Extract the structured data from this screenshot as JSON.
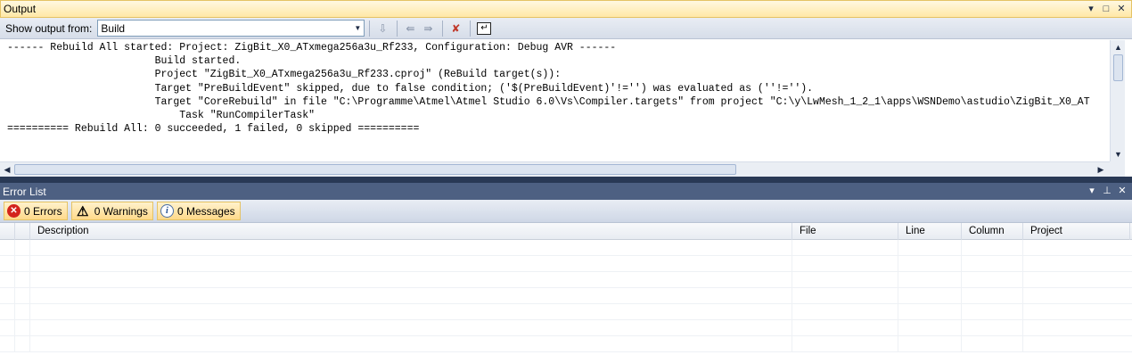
{
  "output": {
    "title": "Output",
    "show_output_label": "Show output from:",
    "source_selected": "Build",
    "lines": [
      "------ Rebuild All started: Project: ZigBit_X0_ATxmega256a3u_Rf233, Configuration: Debug AVR ------",
      "                        Build started.",
      "                        Project \"ZigBit_X0_ATxmega256a3u_Rf233.cproj\" (ReBuild target(s)):",
      "                        Target \"PreBuildEvent\" skipped, due to false condition; ('$(PreBuildEvent)'!='') was evaluated as (''!='').",
      "                        Target \"CoreRebuild\" in file \"C:\\Programme\\Atmel\\Atmel Studio 6.0\\Vs\\Compiler.targets\" from project \"C:\\y\\LwMesh_1_2_1\\apps\\WSNDemo\\astudio\\ZigBit_X0_AT",
      "                            Task \"RunCompilerTask\"",
      "========== Rebuild All: 0 succeeded, 1 failed, 0 skipped =========="
    ]
  },
  "error_list": {
    "title": "Error List",
    "errors_label": "0 Errors",
    "warnings_label": "0 Warnings",
    "messages_label": "0 Messages",
    "columns": [
      "",
      "",
      "Description",
      "File",
      "Line",
      "Column",
      "Project"
    ]
  },
  "colors": {
    "title_active": "#ffe8a6",
    "title_inactive": "#4d6082",
    "frame": "#293955",
    "filter_button": "#ffd98a"
  }
}
